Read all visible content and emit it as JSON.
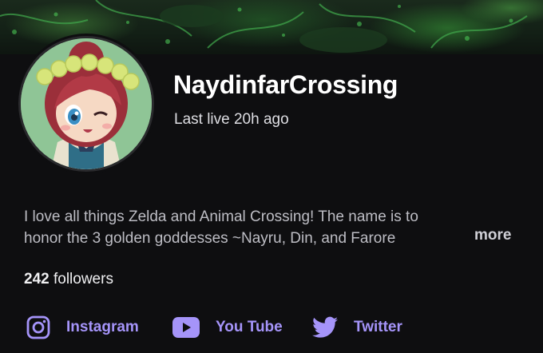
{
  "channel": {
    "name": "NaydinfarCrossing",
    "last_live": "Last live 20h ago",
    "bio_line1": "I love all things Zelda and Animal Crossing!   The name is to",
    "bio_line2": "honor the 3 golden goddesses ~Nayru, Din, and Farore",
    "more_label": "more",
    "followers_count": "242",
    "followers_label": "followers"
  },
  "social_links": [
    {
      "label": "Instagram",
      "icon": "instagram-icon"
    },
    {
      "label": "You Tube",
      "icon": "youtube-icon"
    },
    {
      "label": "Twitter",
      "icon": "twitter-bird-icon"
    }
  ],
  "colors": {
    "background": "#0e0e10",
    "accent": "#a594f9",
    "text_primary": "#efeff1",
    "text_secondary": "#bdbdc4"
  }
}
